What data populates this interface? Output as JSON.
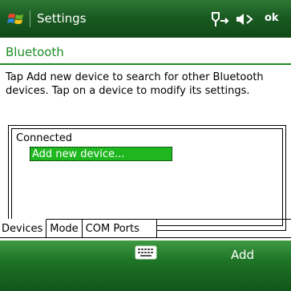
{
  "titlebar": {
    "app_title": "Settings",
    "ok_label": "ok",
    "icons": [
      "windows-start-icon",
      "connectivity-icon",
      "volume-icon"
    ]
  },
  "page": {
    "heading": "Bluetooth",
    "instructions": "Tap Add new device to search for other Bluetooth devices. Tap on a device to modify its settings."
  },
  "device_list": {
    "group_label": "Connected",
    "items": [
      {
        "label": "Add new device..."
      }
    ]
  },
  "tabs": [
    {
      "label": "Devices",
      "active": true
    },
    {
      "label": "Mode",
      "active": false
    },
    {
      "label": "COM Ports",
      "active": false
    }
  ],
  "softkeys": {
    "right_label": "Add",
    "center_icon": "keyboard-icon"
  },
  "colors": {
    "accent_green": "#1c8f24",
    "selection_green": "#1fb71f",
    "bar_green": "#1a5a22"
  }
}
